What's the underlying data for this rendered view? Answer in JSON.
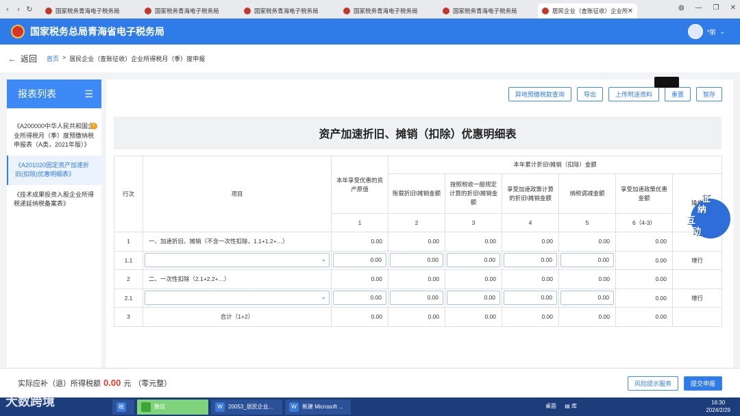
{
  "browser": {
    "tabs": [
      {
        "title": "国家税务青海电子税务局"
      },
      {
        "title": "国家税务青海电子税务局"
      },
      {
        "title": "国家税务青海电子税务局"
      },
      {
        "title": "国家税务青海电子税务局"
      },
      {
        "title": "国家税务青海电子税务局"
      },
      {
        "title": "居民企业（查账征收）企业所"
      }
    ]
  },
  "header": {
    "title": "国家税务总局青海省电子税务局",
    "user": "*丽"
  },
  "breadcrumb": {
    "back": "返回",
    "home": "首页",
    "sep": ">",
    "current": "居民企业（查账征收）企业所得税月（季）度申报"
  },
  "sidebar": {
    "title": "报表列表",
    "items": [
      {
        "label": "《A200000中华人民共和国企业所得税月（季）度预缴纳税申报表（A类，2021年版）》",
        "badge": "!"
      },
      {
        "label": "《A201020固定资产加速折旧(扣除)优惠明细表》"
      },
      {
        "label": "《技术成果投资入股企业所得税递延纳税备案表》"
      }
    ]
  },
  "toolbar": {
    "buttons": [
      "异地预缴税款查询",
      "导出",
      "上传附送资料",
      "重置",
      "暂存"
    ]
  },
  "form": {
    "title": "资产加速折旧、摊销（扣除）优惠明细表",
    "headers": {
      "row_no": "行次",
      "item": "项目",
      "original": "本年享受优惠的资产原值",
      "group": "本年累计折旧\\摊销（扣除）金额",
      "c2": "账载折旧\\摊销金额",
      "c3": "按照税收一般规定计算的折旧\\摊销金额",
      "c4": "享受加速政策计算的折旧\\摊销金额",
      "c5": "纳税调减金额",
      "c6": "享受加速政策优惠金额",
      "op": "操作",
      "n1": "1",
      "n2": "2",
      "n3": "3",
      "n4": "4",
      "n5": "5",
      "n6": "6（4-3）"
    },
    "rows": [
      {
        "no": "1",
        "label": "一、加速折旧、摊销（不含一次性扣除，1.1+1.2+…）",
        "v1": "0.00",
        "v2": "0.00",
        "v3": "0.00",
        "v4": "0.00",
        "v5": "0.00",
        "v6": "0.00",
        "op": ""
      },
      {
        "no": "1.1",
        "label": "",
        "v1": "0.00",
        "v2": "0.00",
        "v3": "0.00",
        "v4": "0.00",
        "v5": "0.00",
        "v6": "0.00",
        "op": "增行"
      },
      {
        "no": "2",
        "label": "二、一次性扣除（2.1+2.2+…）",
        "v1": "0.00",
        "v2": "0.00",
        "v3": "0.00",
        "v4": "0.00",
        "v5": "0.00",
        "v6": "0.00",
        "op": ""
      },
      {
        "no": "2.1",
        "label": "",
        "v1": "0.00",
        "v2": "0.00",
        "v3": "0.00",
        "v4": "0.00",
        "v5": "0.00",
        "v6": "0.00",
        "op": "增行"
      },
      {
        "no": "3",
        "label": "合计（1+2）",
        "v1": "0.00",
        "v2": "0.00",
        "v3": "0.00",
        "v4": "0.00",
        "v5": "0.00",
        "v6": "0.00",
        "op": ""
      }
    ]
  },
  "widget": {
    "line1": "征",
    "line2": "纳",
    "line3": "互",
    "line4": "动"
  },
  "footer": {
    "label": "实际应补（退）所得税额",
    "amount": "0.00",
    "unit": "元",
    "words": "（零元整）",
    "risk_button": "风险提示服务",
    "submit_button": "提交申报"
  },
  "taskbar": {
    "watermark": "大数跨境",
    "task_wechat": "微信",
    "task_doc1": "20053_居民企业...",
    "task_doc2": "新建 Microsoft ...",
    "desktop": "桌面",
    "lib": "库",
    "time": "16:30",
    "date": "2024/2/29"
  }
}
